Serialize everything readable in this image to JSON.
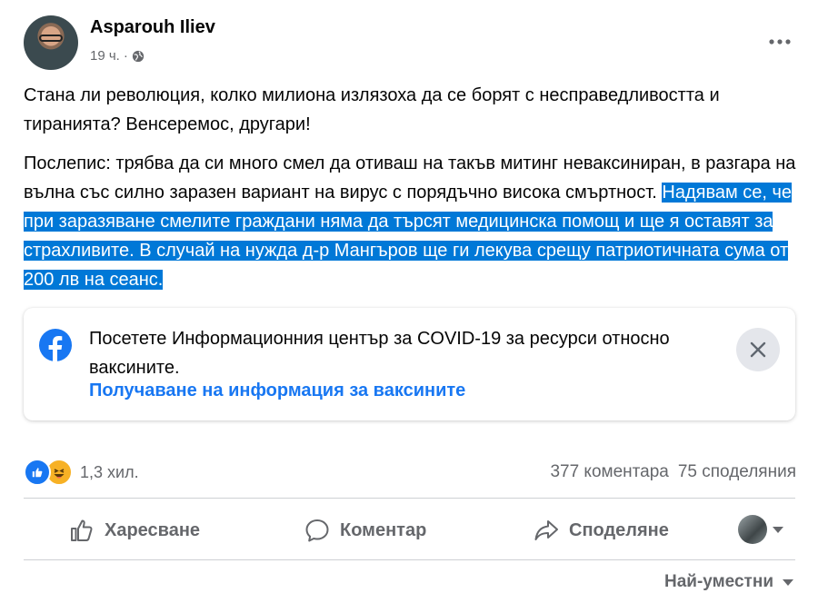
{
  "post": {
    "author": "Asparouh Iliev",
    "time": "19 ч.",
    "separator": "·",
    "paragraph1": "Стана ли революция, колко милиона излязоха да се борят с несправедливостта и тиранията? Венсеремос, другари!",
    "paragraph2_plain": "Послепис: трябва да си много смел да отиваш на такъв митинг неваксиниран, в разгара на вълна със силно заразен вариант на вирус с порядъчно висока смъртност. ",
    "paragraph2_selected": "Надявам се, че при заразяване смелите граждани няма да търсят медицинска помощ и ще я оставят за страхливите. В случай на нужда д-р Мангъров ще ги лекува срещу патриотичната сума от 200 лв на сеанс."
  },
  "covid_card": {
    "text": "Посетете Информационния център за COVID-19 за ресурси относно ваксините.",
    "link": "Получаване на информация за ваксините"
  },
  "reactions": {
    "count": "1,3 хил.",
    "comments": "377 коментара",
    "shares": "75 споделяния"
  },
  "actions": {
    "like": "Харесване",
    "comment": "Коментар",
    "share": "Споделяне"
  },
  "sort": {
    "label": "Най-уместни"
  },
  "colors": {
    "brand_blue": "#1877f2",
    "selection": "#0078d7",
    "muted_text": "#65676b"
  },
  "icons": [
    "globe-icon",
    "more-icon",
    "facebook-icon",
    "close-icon",
    "like-reaction-icon",
    "haha-reaction-icon",
    "thumbs-up-icon",
    "comment-icon",
    "share-icon",
    "chevron-down-icon"
  ]
}
